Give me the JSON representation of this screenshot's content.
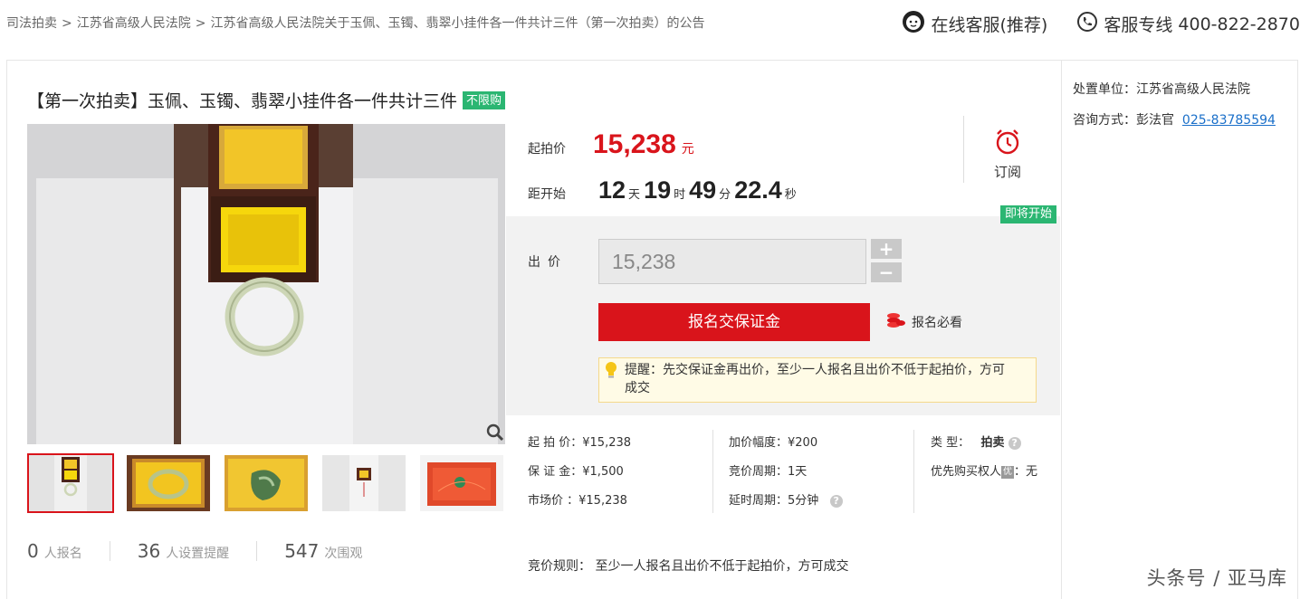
{
  "breadcrumb": {
    "items": [
      "司法拍卖",
      "江苏省高级人民法院",
      "江苏省高级人民法院关于玉佩、玉镯、翡翠小挂件各一件共计三件（第一次拍卖）的公告"
    ],
    "separator": ">"
  },
  "header": {
    "service_label": "在线客服(推荐)",
    "hotline_label": "客服专线",
    "hotline_number": "400-822-2870"
  },
  "item": {
    "title": "【第一次拍卖】玉佩、玉镯、翡翠小挂件各一件共计三件",
    "badge": "不限购"
  },
  "pricing": {
    "start_label": "起拍价",
    "start_value": "15,238",
    "start_unit": "元",
    "countdown_label": "距开始",
    "countdown": [
      {
        "n": "12",
        "u": "天"
      },
      {
        "n": "19",
        "u": "时"
      },
      {
        "n": "49",
        "u": "分"
      },
      {
        "n": "22.4",
        "u": "秒"
      }
    ],
    "subscribe_label": "订阅"
  },
  "bid": {
    "status_badge": "即将开始",
    "label": "出价",
    "input_value": "15,238",
    "plus": "+",
    "minus": "−",
    "signup_button": "报名交保证金",
    "must_read": "报名必看",
    "tip": "提醒：先交保证金再出价，至少一人报名且出价不低于起拍价，方可成交"
  },
  "details": {
    "start_price": {
      "k": "起 拍 价：",
      "v": "¥15,238"
    },
    "deposit": {
      "k": "保 证 金：",
      "v": "¥1,500"
    },
    "market_price": {
      "k": "市场价  ：",
      "v": "¥15,238"
    },
    "increment": {
      "k": "加价幅度：",
      "v": "¥200"
    },
    "bid_period": {
      "k": "竞价周期：",
      "v": "1天"
    },
    "extension": {
      "k": "延时周期：",
      "v": "5分钟"
    },
    "type": {
      "k": "类    型：",
      "v": "拍卖"
    },
    "priority": {
      "k": "优先购买权人",
      "badge": "优",
      "v": "：无"
    },
    "rule": "竞价规则：  至少一人报名且出价不低于起拍价，方可成交"
  },
  "stats": [
    {
      "num": "0",
      "label": "人报名"
    },
    {
      "num": "36",
      "label": "人设置提醒"
    },
    {
      "num": "547",
      "label": "次围观"
    }
  ],
  "sidebar": {
    "org_label": "处置单位：",
    "org_value": "江苏省高级人民法院",
    "contact_label": "咨询方式：",
    "contact_name": "彭法官",
    "contact_phone": "025-83785594"
  },
  "watermark": "头条号 / 亚马库",
  "colors": {
    "accent_red": "#d9141b",
    "green": "#2bb672",
    "link_blue": "#1a6fc9"
  }
}
